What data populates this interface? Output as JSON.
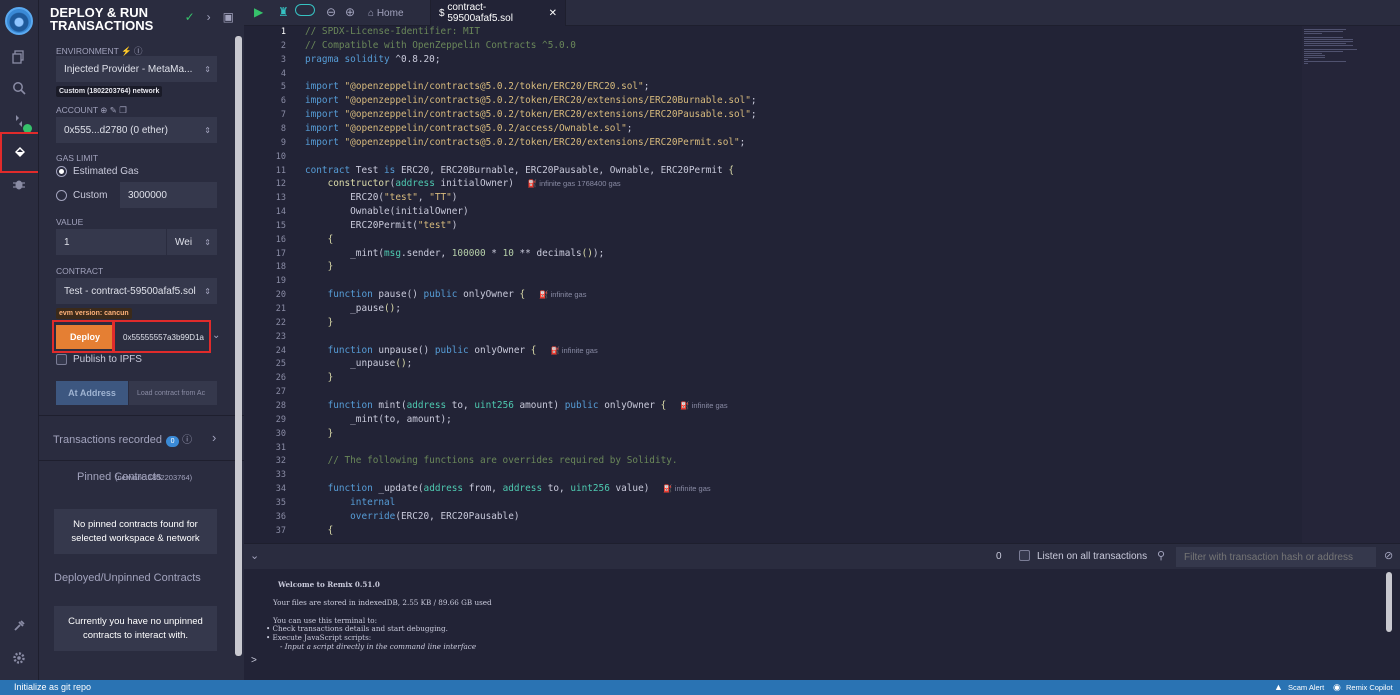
{
  "panel": {
    "title": "DEPLOY & RUN TRANSACTIONS",
    "environment_label": "ENVIRONMENT",
    "environment_value": "Injected Provider - MetaMa...",
    "network_tag": "Custom (1802203764) network",
    "account_label": "ACCOUNT",
    "account_value": "0x555...d2780 (0 ether)",
    "gas_limit_label": "GAS LIMIT",
    "estimated_gas_label": "Estimated Gas",
    "custom_label": "Custom",
    "custom_gas_value": "3000000",
    "value_label": "VALUE",
    "value_amount": "1",
    "value_unit": "Wei",
    "contract_label": "CONTRACT",
    "contract_value": "Test - contract-59500afaf5.sol",
    "evm_tag": "evm version: cancun",
    "deploy_label": "Deploy",
    "deploy_arg": "0x55555557a3b99D1a",
    "publish_label": "Publish to IPFS",
    "at_address_label": "At Address",
    "load_contract_placeholder": "Load contract from Ac",
    "transactions_recorded_label": "Transactions recorded",
    "transactions_count": "0",
    "pinned_title": "Pinned Contracts",
    "pinned_network": "(network: 1802203764)",
    "pinned_empty": "No pinned contracts found for selected workspace & network",
    "deployed_title": "Deployed/Unpinned Contracts",
    "deployed_empty": "Currently you have no unpinned contracts to interact with."
  },
  "tabs": {
    "home": "Home",
    "file": "contract-59500afaf5.sol"
  },
  "gas": {
    "g12": "infinite gas 1768400 gas",
    "g20": "infinite gas",
    "g24": "infinite gas",
    "g28": "infinite gas",
    "g34": "infinite gas"
  },
  "terminal": {
    "count": "0",
    "listen_label": "Listen on all transactions",
    "filter_placeholder": "Filter with transaction hash or address",
    "welcome": "Welcome to Remix 0.51.0",
    "storage": "Your files are stored in indexedDB, 2.55 KB / 89.66 GB used",
    "use_terminal": "You can use this terminal to:",
    "bullet1": "Check transactions details and start debugging.",
    "bullet2": "Execute JavaScript scripts:",
    "bullet3": "- Input a script directly in the command line interface",
    "prompt": ">"
  },
  "status": {
    "left": "Initialize as git repo",
    "scam": "Scam Alert",
    "copilot": "Remix Copilot"
  }
}
